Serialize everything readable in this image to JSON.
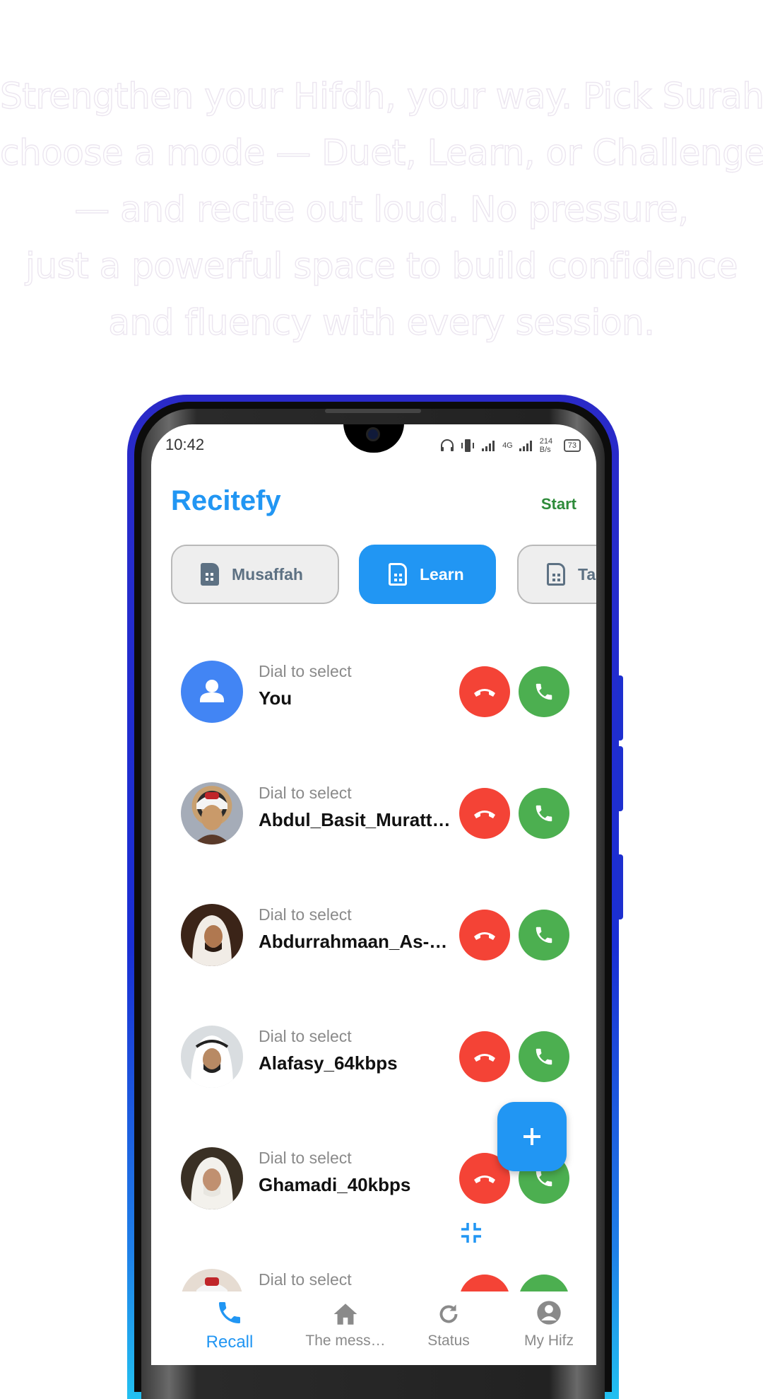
{
  "headline": {
    "lines": [
      "Strengthen your Hifdh, your way. Pick Surah",
      "choose a mode — Duet, Learn, or Challenge",
      "— and recite out loud. No pressure,",
      "just a powerful space to build confidence",
      "and fluency with every session."
    ]
  },
  "status_bar": {
    "time": "10:42",
    "network": "4G",
    "speed": "214 B/s",
    "battery": "73"
  },
  "app": {
    "title": "Recitefy",
    "start_label": "Start"
  },
  "chips": [
    {
      "label": "Musaffah",
      "active": false
    },
    {
      "label": "Learn",
      "active": true
    },
    {
      "label": "Ta",
      "active": false
    }
  ],
  "reciters": [
    {
      "subtitle": "Dial to select",
      "name": "You",
      "avatar": "person-icon"
    },
    {
      "subtitle": "Dial to select",
      "name": "Abdul_Basit_Muratt…",
      "avatar": "reciter-photo"
    },
    {
      "subtitle": "Dial to select",
      "name": "Abdurrahmaan_As-…",
      "avatar": "reciter-photo"
    },
    {
      "subtitle": "Dial to select",
      "name": "Alafasy_64kbps",
      "avatar": "reciter-photo"
    },
    {
      "subtitle": "Dial to select",
      "name": "Ghamadi_40kbps",
      "avatar": "reciter-photo"
    },
    {
      "subtitle": "Dial to select",
      "name": "",
      "avatar": "reciter-photo"
    }
  ],
  "bottom_nav": [
    {
      "label": "Recall",
      "icon": "phone-icon",
      "active": true
    },
    {
      "label": "The mess…",
      "icon": "home-icon",
      "active": false
    },
    {
      "label": "Status",
      "icon": "refresh-icon",
      "active": false
    },
    {
      "label": "My Hifz",
      "icon": "account-circle-icon",
      "active": false
    }
  ],
  "colors": {
    "accent": "#2196f3",
    "decline": "#f44336",
    "accept": "#4caf50",
    "start": "#2e8b3a"
  }
}
